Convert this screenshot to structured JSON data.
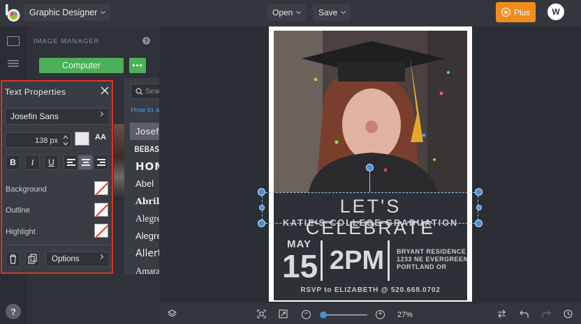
{
  "header": {
    "app_name": "Graphic Designer",
    "open_label": "Open",
    "save_label": "Save",
    "plus_label": "Plus",
    "avatar_initial": "W"
  },
  "image_manager": {
    "title": "IMAGE MANAGER",
    "help": "?",
    "computer_label": "Computer",
    "more_label": "•••"
  },
  "text_properties": {
    "title": "Text Properties",
    "font_name": "Josefin Sans",
    "size_value": "138 px",
    "case_label": "AA",
    "bold_label": "B",
    "italic_label": "I",
    "underline_label": "U",
    "background_label": "Background",
    "outline_label": "Outline",
    "highlight_label": "Highlight",
    "options_label": "Options"
  },
  "font_picker": {
    "search_placeholder": "Search Ours & Yours",
    "help_link": "How to add your fonts",
    "fonts": [
      {
        "name": "Josefin Sans",
        "selected": true
      },
      {
        "name": "BEBAS NEUE",
        "selected": false
      },
      {
        "name": "HOMINIS",
        "selected": false
      },
      {
        "name": "Abel",
        "selected": false
      },
      {
        "name": "Abril Fatface",
        "selected": false
      },
      {
        "name": "Alegreya",
        "selected": false
      },
      {
        "name": "Alegreya Sans",
        "selected": false
      },
      {
        "name": "Allerta Stencil",
        "selected": false
      },
      {
        "name": "Amaranth",
        "selected": false
      }
    ]
  },
  "design": {
    "headline": "LET'S CELEBRATE",
    "subheadline": "KATIE'S COLLEGE GRADUATION",
    "month": "MAY",
    "day": "15",
    "time": "2PM",
    "address_line1": "BRYANT RESIDENCE",
    "address_line2": "1233 NE EVERGREEN",
    "address_line3": "PORTLAND OR",
    "rsvp": "RSVP to ELIZABETH @ 520.668.0702"
  },
  "bottom_bar": {
    "zoom_value": "27%",
    "zoom_level": 0.27
  },
  "left_rail": {
    "help": "?"
  },
  "colors": {
    "accent_green": "#4caf5a",
    "plus_orange": "#f08b1d",
    "selection_blue": "#4a90d9",
    "highlight_red": "#e5322a"
  }
}
